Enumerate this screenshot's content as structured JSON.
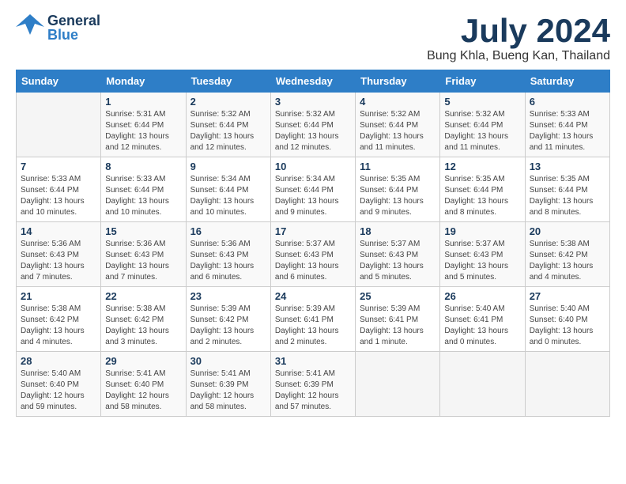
{
  "header": {
    "logo_general": "General",
    "logo_blue": "Blue",
    "month_title": "July 2024",
    "location": "Bung Khla, Bueng Kan, Thailand"
  },
  "days_of_week": [
    "Sunday",
    "Monday",
    "Tuesday",
    "Wednesday",
    "Thursday",
    "Friday",
    "Saturday"
  ],
  "weeks": [
    [
      {
        "day": "",
        "info": ""
      },
      {
        "day": "1",
        "info": "Sunrise: 5:31 AM\nSunset: 6:44 PM\nDaylight: 13 hours\nand 12 minutes."
      },
      {
        "day": "2",
        "info": "Sunrise: 5:32 AM\nSunset: 6:44 PM\nDaylight: 13 hours\nand 12 minutes."
      },
      {
        "day": "3",
        "info": "Sunrise: 5:32 AM\nSunset: 6:44 PM\nDaylight: 13 hours\nand 12 minutes."
      },
      {
        "day": "4",
        "info": "Sunrise: 5:32 AM\nSunset: 6:44 PM\nDaylight: 13 hours\nand 11 minutes."
      },
      {
        "day": "5",
        "info": "Sunrise: 5:32 AM\nSunset: 6:44 PM\nDaylight: 13 hours\nand 11 minutes."
      },
      {
        "day": "6",
        "info": "Sunrise: 5:33 AM\nSunset: 6:44 PM\nDaylight: 13 hours\nand 11 minutes."
      }
    ],
    [
      {
        "day": "7",
        "info": "Sunrise: 5:33 AM\nSunset: 6:44 PM\nDaylight: 13 hours\nand 10 minutes."
      },
      {
        "day": "8",
        "info": "Sunrise: 5:33 AM\nSunset: 6:44 PM\nDaylight: 13 hours\nand 10 minutes."
      },
      {
        "day": "9",
        "info": "Sunrise: 5:34 AM\nSunset: 6:44 PM\nDaylight: 13 hours\nand 10 minutes."
      },
      {
        "day": "10",
        "info": "Sunrise: 5:34 AM\nSunset: 6:44 PM\nDaylight: 13 hours\nand 9 minutes."
      },
      {
        "day": "11",
        "info": "Sunrise: 5:35 AM\nSunset: 6:44 PM\nDaylight: 13 hours\nand 9 minutes."
      },
      {
        "day": "12",
        "info": "Sunrise: 5:35 AM\nSunset: 6:44 PM\nDaylight: 13 hours\nand 8 minutes."
      },
      {
        "day": "13",
        "info": "Sunrise: 5:35 AM\nSunset: 6:44 PM\nDaylight: 13 hours\nand 8 minutes."
      }
    ],
    [
      {
        "day": "14",
        "info": "Sunrise: 5:36 AM\nSunset: 6:43 PM\nDaylight: 13 hours\nand 7 minutes."
      },
      {
        "day": "15",
        "info": "Sunrise: 5:36 AM\nSunset: 6:43 PM\nDaylight: 13 hours\nand 7 minutes."
      },
      {
        "day": "16",
        "info": "Sunrise: 5:36 AM\nSunset: 6:43 PM\nDaylight: 13 hours\nand 6 minutes."
      },
      {
        "day": "17",
        "info": "Sunrise: 5:37 AM\nSunset: 6:43 PM\nDaylight: 13 hours\nand 6 minutes."
      },
      {
        "day": "18",
        "info": "Sunrise: 5:37 AM\nSunset: 6:43 PM\nDaylight: 13 hours\nand 5 minutes."
      },
      {
        "day": "19",
        "info": "Sunrise: 5:37 AM\nSunset: 6:43 PM\nDaylight: 13 hours\nand 5 minutes."
      },
      {
        "day": "20",
        "info": "Sunrise: 5:38 AM\nSunset: 6:42 PM\nDaylight: 13 hours\nand 4 minutes."
      }
    ],
    [
      {
        "day": "21",
        "info": "Sunrise: 5:38 AM\nSunset: 6:42 PM\nDaylight: 13 hours\nand 4 minutes."
      },
      {
        "day": "22",
        "info": "Sunrise: 5:38 AM\nSunset: 6:42 PM\nDaylight: 13 hours\nand 3 minutes."
      },
      {
        "day": "23",
        "info": "Sunrise: 5:39 AM\nSunset: 6:42 PM\nDaylight: 13 hours\nand 2 minutes."
      },
      {
        "day": "24",
        "info": "Sunrise: 5:39 AM\nSunset: 6:41 PM\nDaylight: 13 hours\nand 2 minutes."
      },
      {
        "day": "25",
        "info": "Sunrise: 5:39 AM\nSunset: 6:41 PM\nDaylight: 13 hours\nand 1 minute."
      },
      {
        "day": "26",
        "info": "Sunrise: 5:40 AM\nSunset: 6:41 PM\nDaylight: 13 hours\nand 0 minutes."
      },
      {
        "day": "27",
        "info": "Sunrise: 5:40 AM\nSunset: 6:40 PM\nDaylight: 13 hours\nand 0 minutes."
      }
    ],
    [
      {
        "day": "28",
        "info": "Sunrise: 5:40 AM\nSunset: 6:40 PM\nDaylight: 12 hours\nand 59 minutes."
      },
      {
        "day": "29",
        "info": "Sunrise: 5:41 AM\nSunset: 6:40 PM\nDaylight: 12 hours\nand 58 minutes."
      },
      {
        "day": "30",
        "info": "Sunrise: 5:41 AM\nSunset: 6:39 PM\nDaylight: 12 hours\nand 58 minutes."
      },
      {
        "day": "31",
        "info": "Sunrise: 5:41 AM\nSunset: 6:39 PM\nDaylight: 12 hours\nand 57 minutes."
      },
      {
        "day": "",
        "info": ""
      },
      {
        "day": "",
        "info": ""
      },
      {
        "day": "",
        "info": ""
      }
    ]
  ]
}
